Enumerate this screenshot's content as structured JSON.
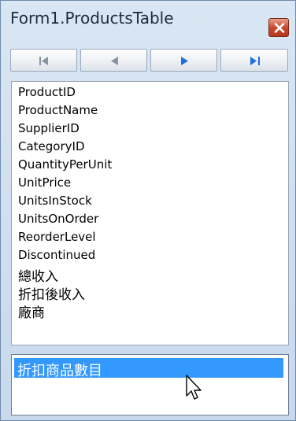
{
  "window": {
    "title": "Form1.ProductsTable"
  },
  "navigator": {
    "buttons": [
      {
        "name": "move-first"
      },
      {
        "name": "move-previous"
      },
      {
        "name": "move-next"
      },
      {
        "name": "move-last"
      }
    ]
  },
  "fields": [
    "ProductID",
    "ProductName",
    "SupplierID",
    "CategoryID",
    "QuantityPerUnit",
    "UnitPrice",
    "UnitsInStock",
    "UnitsOnOrder",
    "ReorderLevel",
    "Discontinued",
    "總收入",
    "折扣後收入",
    "廠商"
  ],
  "editor": {
    "selected_text": "折扣商品數目"
  },
  "colors": {
    "selection": "#3399ff",
    "close_button": "#c64a2f",
    "nav_active_arrow": "#1e6fe0",
    "nav_disabled_arrow": "#8a95a3"
  }
}
